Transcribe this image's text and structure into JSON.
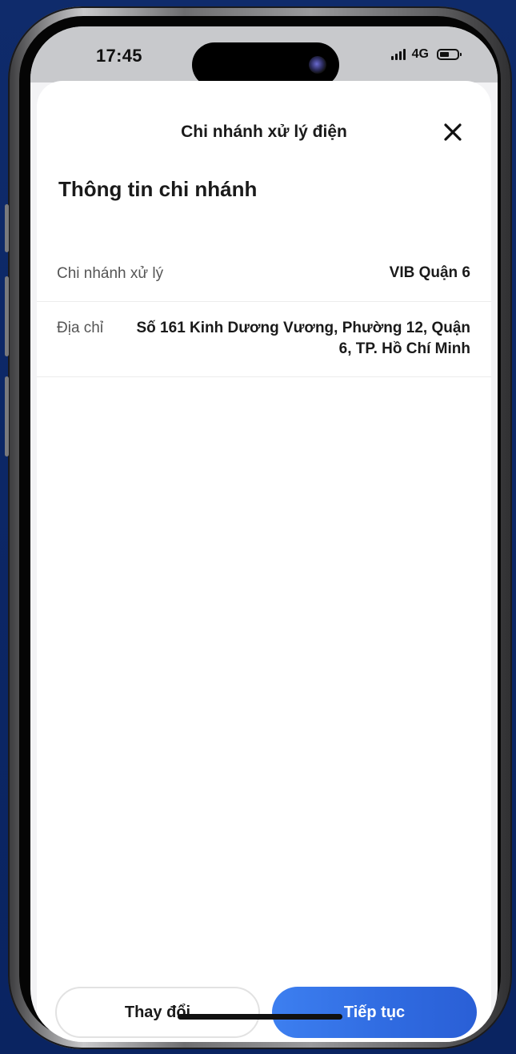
{
  "status_bar": {
    "time": "17:45",
    "network": "4G",
    "battery_level": 0.55
  },
  "sheet": {
    "title": "Chi nhánh xử lý điện",
    "close_icon": "close-icon"
  },
  "branch_info": {
    "section_title": "Thông tin chi nhánh",
    "rows": [
      {
        "label": "Chi nhánh xử lý",
        "value": "VIB Quận 6"
      },
      {
        "label": "Địa chỉ",
        "value_line1": "Số 161 Kinh Dương Vương, Phường 12, Quận",
        "value_line2": "6, TP. Hồ Chí Minh"
      }
    ]
  },
  "actions": {
    "secondary_label": "Thay đổi",
    "primary_label": "Tiếp tục",
    "primary_color": "#2f6ae0"
  }
}
